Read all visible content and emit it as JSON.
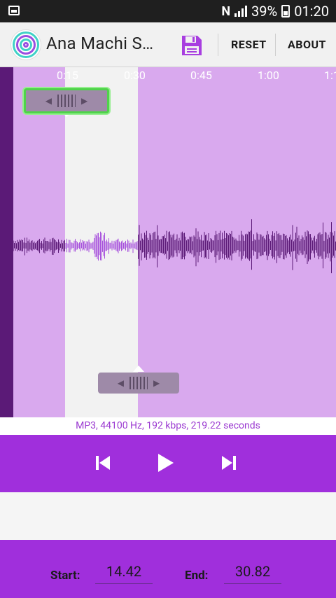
{
  "status_bar": {
    "battery_percent": "39%",
    "time": "01:20",
    "nfc_glyph": "N"
  },
  "app_bar": {
    "title": "Ana Machi S…",
    "save_icon": "save-icon",
    "reset_label": "RESET",
    "about_label": "ABOUT"
  },
  "timeline": {
    "ticks": [
      "0:15",
      "0:30",
      "0:45",
      "1:00",
      "1:1"
    ]
  },
  "file_info": "MP3, 44100 Hz, 192 kbps, 219.22 seconds",
  "controls": {
    "prev_icon": "skip-previous-icon",
    "play_icon": "play-icon",
    "next_icon": "skip-next-icon"
  },
  "range": {
    "start_label": "Start:",
    "start_value": "14.42",
    "end_label": "End:",
    "end_value": "30.82"
  },
  "colors": {
    "accent": "#a02fdc",
    "waveform_bg": "#d9a9ee",
    "waveform": "#5b1a77",
    "selection": "#f2f2f2"
  }
}
